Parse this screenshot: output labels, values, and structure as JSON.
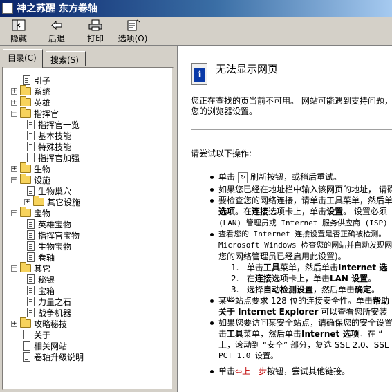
{
  "window": {
    "title": "神之苏醒 东方卷轴"
  },
  "toolbar": {
    "hide": {
      "label": "隐藏",
      "icon": "hide-icon"
    },
    "back": {
      "label": "后退",
      "icon": "back-arrow-icon"
    },
    "print": {
      "label": "打印",
      "icon": "printer-icon"
    },
    "options": {
      "label": "选项(O)",
      "icon": "options-icon"
    }
  },
  "tabs": [
    {
      "label": "目录(C)"
    },
    {
      "label": "搜索(S)"
    }
  ],
  "tree": [
    {
      "label": "引子"
    },
    {
      "label": "系统"
    },
    {
      "label": "英雄"
    },
    {
      "label": "指挥官"
    },
    {
      "label": "指挥官一览"
    },
    {
      "label": "基本技能"
    },
    {
      "label": "特殊技能"
    },
    {
      "label": "指挥官加强"
    },
    {
      "label": "生物"
    },
    {
      "label": "设施"
    },
    {
      "label": "生物巢穴"
    },
    {
      "label": "其它设施"
    },
    {
      "label": "宝物"
    },
    {
      "label": "英雄宝物"
    },
    {
      "label": "指挥官宝物"
    },
    {
      "label": "生物宝物"
    },
    {
      "label": "卷轴"
    },
    {
      "label": "其它"
    },
    {
      "label": "秘银"
    },
    {
      "label": "宝箱"
    },
    {
      "label": "力量之石"
    },
    {
      "label": "战争机器"
    },
    {
      "label": "攻略秘技"
    },
    {
      "label": "关于"
    },
    {
      "label": "相关网站"
    },
    {
      "label": "卷轴升级说明"
    }
  ],
  "content": {
    "heading": "无法显示网页",
    "intro1": "您正在查找的页当前不可用。 网站可能遇到支持问题，",
    "intro2": "您的浏览器设置。",
    "try": "请尝试以下操作:",
    "b1a": "单击",
    "b1b": "刷新按钮，或稍后重试。",
    "b2": "如果您已经在地址栏中输入该网页的地址， 请确",
    "b3a": "要检查您的网络连接，请单击工具菜单，然后单",
    "b3b1": "选项",
    "b3b2": "。在",
    "b3b3": "连接",
    "b3b4": "选项卡上，单击",
    "b3b5": "设置",
    "b3b6": "。 设置必须",
    "b3c": "(LAN) 管理员或 Internet 服务供应商 (ISP) 提",
    "b4a": "查看您的 Internet 连接设置是否正确被检测。",
    "b4b": "Microsoft Windows 检查您的网站并自动发现网",
    "b4c": "您的网络管理员已经启用此设置)。",
    "s1n": "1.",
    "s1a": "单击",
    "s1b": "工具",
    "s1c": "菜单，然后单击",
    "s1d": "Internet 选",
    "s2n": "2.",
    "s2a": "在",
    "s2b": "连接",
    "s2c": "选项卡上，单击",
    "s2d": "LAN 设置",
    "s2e": "。",
    "s3n": "3.",
    "s3a": "选择",
    "s3b": "自动检测设置",
    "s3c": "，然后单击",
    "s3d": "确定",
    "s3e": "。",
    "b5a1": "某些站点要求 128-位的连接安全性。单击",
    "b5a2": "帮助",
    "b5b1": "关于 Internet Explorer",
    "b5b2": " 可以查看您所安装",
    "b6a": "如果您要访问某安全站点，请确保您的安全设置",
    "b6b1": "击",
    "b6b2": "工具",
    "b6b3": "菜单，然后单击",
    "b6b4": "Internet 选项",
    "b6b5": "。在 “",
    "b6c": "上，滚动到 “安全” 部分，复选 SSL 2.0、SSL",
    "b6d": "PCT 1.0 设置。",
    "b7a": "单击",
    "b7link": "上一步",
    "b7b": "按钮，尝试其他链接。"
  }
}
